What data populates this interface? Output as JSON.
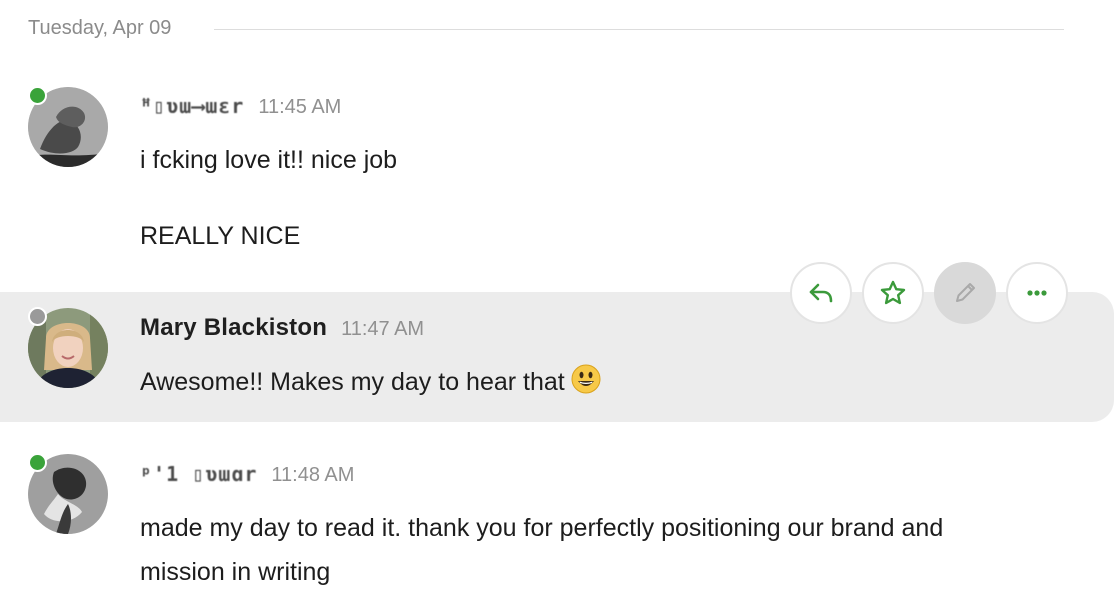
{
  "date_divider": "Tuesday, Apr 09",
  "messages": [
    {
      "author": "ꟸ▯ʋɯ⟶ɯɛr",
      "time": "11:45 AM",
      "lines": [
        "i fcking love it!! nice job",
        "REALLY NICE"
      ],
      "presence": "online"
    },
    {
      "author": "Mary Blackiston",
      "time": "11:47 AM",
      "lines": [
        "Awesome!! Makes my day to hear that"
      ],
      "emoji": "grinning-face",
      "presence": "offline"
    },
    {
      "author": "ᵖ'1 ▯ʋɯɑr",
      "time": "11:48 AM",
      "lines": [
        "made my day to read it. thank you for perfectly positioning our brand and",
        "mission in writing"
      ],
      "presence": "online"
    }
  ],
  "hover_actions": [
    "reply",
    "star",
    "edit",
    "more"
  ],
  "colors": {
    "online": "#3aa33a",
    "offline": "#9a9a9a",
    "accent": "#3b9a3b"
  }
}
